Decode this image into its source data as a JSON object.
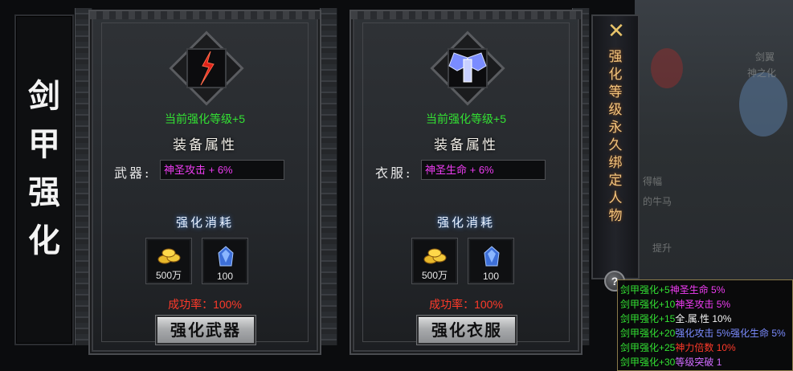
{
  "title": {
    "chars": [
      "剑",
      "甲",
      "强",
      "化"
    ]
  },
  "panels": [
    {
      "level": "当前强化等级+5",
      "attr_heading": "装备属性",
      "attr_label": "武器:",
      "attr_value": "神圣攻击 + 6%",
      "cost_heading": "强化消耗",
      "cost_items": [
        {
          "icon": "gold-coins-icon",
          "qty": "500万"
        },
        {
          "icon": "blue-gem-icon",
          "qty": "100"
        }
      ],
      "success": "成功率：100%",
      "button": "强化武器"
    },
    {
      "level": "当前强化等级+5",
      "attr_heading": "装备属性",
      "attr_label": "衣服:",
      "attr_value": "神圣生命 + 6%",
      "cost_heading": "强化消耗",
      "cost_items": [
        {
          "icon": "gold-coins-icon",
          "qty": "500万"
        },
        {
          "icon": "blue-gem-icon",
          "qty": "100"
        }
      ],
      "success": "成功率：100%",
      "button": "强化衣服"
    }
  ],
  "banner": {
    "chars": [
      "强",
      "化",
      "等",
      "级",
      "永",
      "久",
      "绑",
      "定",
      "人",
      "物"
    ]
  },
  "help": "?",
  "background": {
    "text1": "剑翼",
    "text2": "神之化",
    "text3": "得幅",
    "text4": "的牛马",
    "text5": "提升"
  },
  "tooltip": [
    {
      "prefix": "剑甲强化+5",
      "parts": [
        {
          "text": "神圣生命 5%",
          "color": "pink"
        }
      ]
    },
    {
      "prefix": "剑甲强化+10",
      "parts": [
        {
          "text": "神圣攻击 5%",
          "color": "pink"
        }
      ]
    },
    {
      "prefix": "剑甲强化+15",
      "parts": [
        {
          "text": "全.属.性 10%",
          "color": "white"
        }
      ]
    },
    {
      "prefix": "剑甲强化+20",
      "parts": [
        {
          "text": "强化攻击 5%",
          "color": "blue"
        },
        {
          "text": "强化生命 5%",
          "color": "blue"
        }
      ]
    },
    {
      "prefix": "剑甲强化+25",
      "parts": [
        {
          "text": "神力倍数 10%",
          "color": "red"
        }
      ]
    },
    {
      "prefix": "剑甲强化+30",
      "parts": [
        {
          "text": "等级突破 1",
          "color": "purple"
        }
      ]
    }
  ],
  "colors": {
    "green": "#33e233",
    "pink": "#ee3cf2",
    "red": "#ff3a2a",
    "gold": "#f3c47c"
  }
}
